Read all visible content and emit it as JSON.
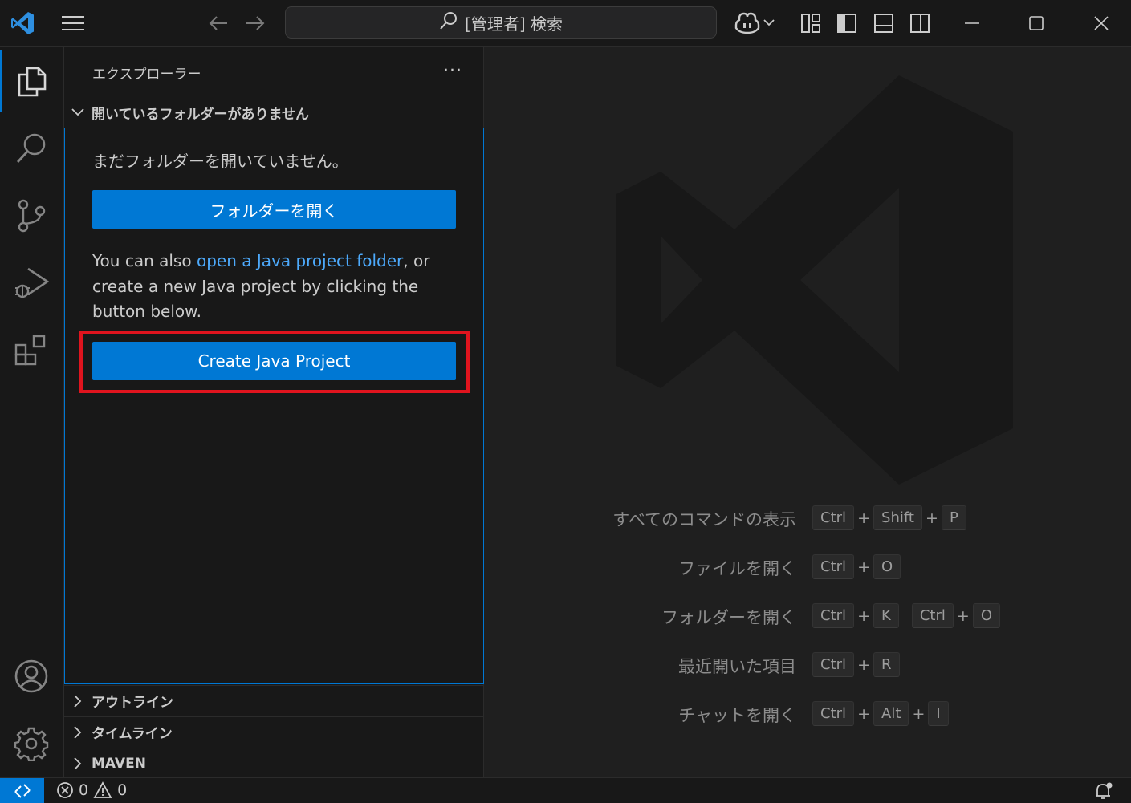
{
  "titlebar": {
    "search_text": "[管理者] 検索",
    "icons": [
      "vscode-logo-icon",
      "menu-icon",
      "back-arrow-icon",
      "forward-arrow-icon",
      "search-icon",
      "copilot-icon",
      "chevron-down-icon",
      "customize-layout-icon",
      "toggle-primary-sidebar-icon",
      "toggle-panel-icon",
      "toggle-secondary-sidebar-icon",
      "minimize-icon",
      "maximize-icon",
      "close-icon"
    ]
  },
  "activitybar": {
    "items": [
      "explorer-icon",
      "search-icon",
      "source-control-icon",
      "run-and-debug-icon",
      "extensions-icon",
      "accounts-icon",
      "manage-gear-icon"
    ]
  },
  "sidebar": {
    "title": "エクスプローラー",
    "more_label": "···",
    "folder_section": {
      "header": "開いているフォルダーがありません",
      "message": "まだフォルダーを開いていません。",
      "open_folder_button": "フォルダーを開く",
      "java_text_before": "You can also ",
      "java_link": "open a Java project folder",
      "java_text_after": ", or create a new Java project by clicking the button below.",
      "create_java_button": "Create Java Project"
    },
    "bottom_sections": [
      "アウトライン",
      "タイムライン",
      "MAVEN"
    ]
  },
  "editor": {
    "shortcuts": [
      {
        "label": "すべてのコマンドの表示",
        "keys": [
          "Ctrl",
          "+",
          "Shift",
          "+",
          "P"
        ]
      },
      {
        "label": "ファイルを開く",
        "keys": [
          "Ctrl",
          "+",
          "O"
        ]
      },
      {
        "label": "フォルダーを開く",
        "keys": [
          "Ctrl",
          "+",
          "K",
          " ",
          "Ctrl",
          "+",
          "O"
        ]
      },
      {
        "label": "最近開いた項目",
        "keys": [
          "Ctrl",
          "+",
          "R"
        ]
      },
      {
        "label": "チャットを開く",
        "keys": [
          "Ctrl",
          "+",
          "Alt",
          "+",
          "I"
        ]
      }
    ]
  },
  "statusbar": {
    "errors": "0",
    "warnings": "0"
  },
  "colors": {
    "accent": "#0078d4",
    "link": "#4daafc",
    "highlight_border": "#e0141e",
    "background": "#1f1f1f",
    "sidebar_bg": "#181818"
  }
}
